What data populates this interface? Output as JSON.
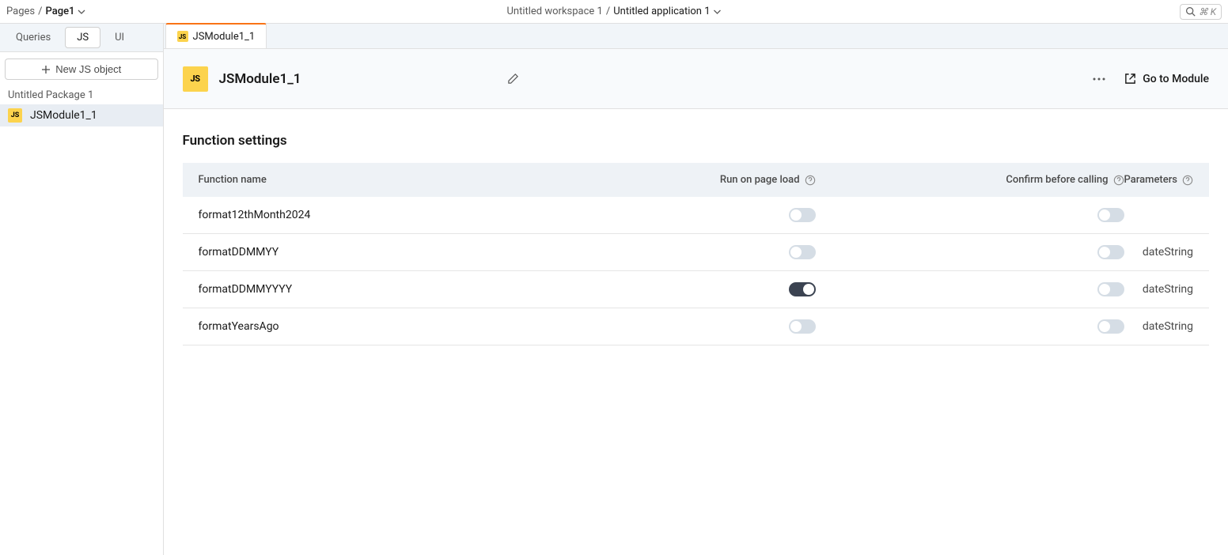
{
  "breadcrumb": {
    "root": "Pages",
    "sep": "/",
    "page": "Page1"
  },
  "workspace": {
    "ws": "Untitled workspace 1",
    "sep": "/",
    "app": "Untitled application 1"
  },
  "search": {
    "shortcut": "⌘ K"
  },
  "sidebar": {
    "tabs": {
      "queries": "Queries",
      "js": "JS",
      "ui": "UI"
    },
    "newBtn": "New JS object",
    "package": "Untitled Package 1",
    "item": "JSModule1_1"
  },
  "fileTab": "JSModule1_1",
  "header": {
    "title": "JSModule1_1",
    "goto": "Go to Module"
  },
  "section": "Function settings",
  "columns": {
    "name": "Function name",
    "run": "Run on page load",
    "confirm": "Confirm before calling",
    "params": "Parameters"
  },
  "rows": [
    {
      "name": "format12thMonth2024",
      "run": false,
      "confirm": false,
      "params": ""
    },
    {
      "name": "formatDDMMYY",
      "run": false,
      "confirm": false,
      "params": "dateString"
    },
    {
      "name": "formatDDMMYYYY",
      "run": true,
      "confirm": false,
      "params": "dateString"
    },
    {
      "name": "formatYearsAgo",
      "run": false,
      "confirm": false,
      "params": "dateString"
    }
  ]
}
